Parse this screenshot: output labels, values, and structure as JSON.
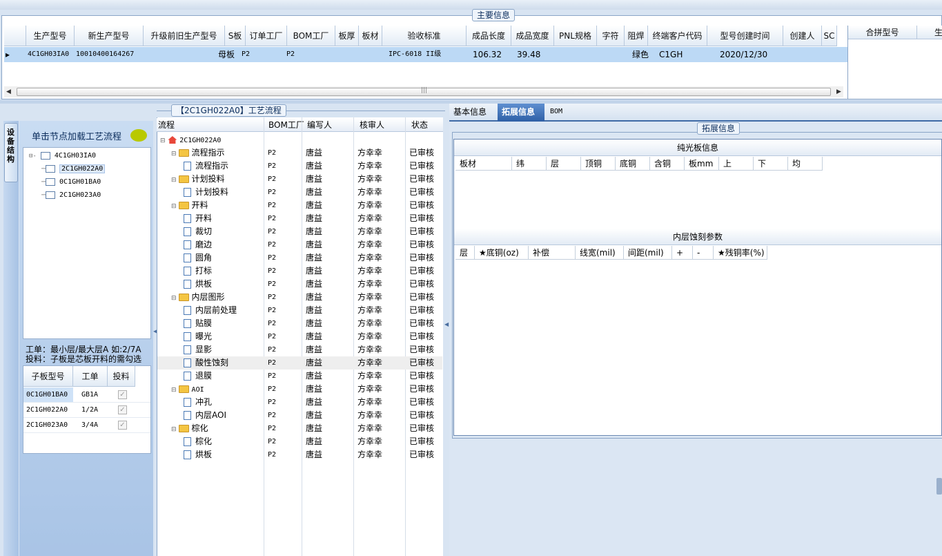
{
  "main_info": {
    "group_title": "主要信息",
    "columns": [
      "生产型号",
      "新生产型号",
      "升级前旧生产型号",
      "S板",
      "订单工厂",
      "BOM工厂",
      "板厚",
      "板材",
      "验收标准",
      "成品长度",
      "成品宽度",
      "PNL规格",
      "字符",
      "阻焊",
      "终端客户代码",
      "型号创建时间",
      "创建人",
      "SC"
    ],
    "row": {
      "pointer": "▸",
      "prod_model": "4C1GH03IA0",
      "new_model": "10010400164267",
      "s_board": "母板",
      "order_factory": "P2",
      "bom_factory": "P2",
      "standard": "IPC-6018 II级",
      "length": "106.32",
      "width": "39.48",
      "solder": "绿色",
      "customer": "C1GH",
      "created": "2020/12/30"
    },
    "side_columns": [
      "合拼型号",
      "生"
    ],
    "scroll_grip": "|||"
  },
  "left": {
    "side_tab": "设备结构",
    "load_label": "单击节点加载工艺流程",
    "tree": {
      "root": "4C1GH03IA0",
      "children": [
        "2C1GH022A0",
        "0C1GH01BA0",
        "2C1GH023A0"
      ]
    },
    "note1": "工单：最小层/最大层A 如:2/7A",
    "note2": "投料：子板是芯板开料的需勾选",
    "sub_headers": [
      "子板型号",
      "工单",
      "投料"
    ],
    "sub_rows": [
      {
        "model": "0C1GH01BA0",
        "order": "GB1A"
      },
      {
        "model": "2C1GH022A0",
        "order": "1/2A"
      },
      {
        "model": "2C1GH023A0",
        "order": "3/4A"
      }
    ],
    "check": "✓"
  },
  "flow": {
    "title": "【2C1GH022A0】工艺流程",
    "headers": [
      "流程",
      "BOM工厂",
      "编写人",
      "核审人",
      "状态"
    ],
    "root": "2C1GH022A0",
    "factory": "P2",
    "writer": "唐益",
    "reviewer": "方幸幸",
    "status": "已审核",
    "rows": [
      {
        "label": "流程指示",
        "type": "folder"
      },
      {
        "label": "流程指示",
        "type": "doc"
      },
      {
        "label": "计划投料",
        "type": "folder"
      },
      {
        "label": "计划投料",
        "type": "doc"
      },
      {
        "label": "开料",
        "type": "folder"
      },
      {
        "label": "开料",
        "type": "doc"
      },
      {
        "label": "裁切",
        "type": "doc"
      },
      {
        "label": "磨边",
        "type": "doc"
      },
      {
        "label": "圆角",
        "type": "doc"
      },
      {
        "label": "打标",
        "type": "doc"
      },
      {
        "label": "烘板",
        "type": "doc"
      },
      {
        "label": "内层图形",
        "type": "folder"
      },
      {
        "label": "内层前处理",
        "type": "doc"
      },
      {
        "label": "贴膜",
        "type": "doc"
      },
      {
        "label": "曝光",
        "type": "doc"
      },
      {
        "label": "显影",
        "type": "doc"
      },
      {
        "label": "酸性蚀刻",
        "type": "doc",
        "selected": true
      },
      {
        "label": "退膜",
        "type": "doc"
      },
      {
        "label": "AOI",
        "type": "folder"
      },
      {
        "label": "冲孔",
        "type": "doc"
      },
      {
        "label": "内层AOI",
        "type": "doc"
      },
      {
        "label": "棕化",
        "type": "folder"
      },
      {
        "label": "棕化",
        "type": "doc"
      },
      {
        "label": "烘板",
        "type": "doc"
      }
    ]
  },
  "right": {
    "tabs": [
      "基本信息",
      "拓展信息",
      "BOM"
    ],
    "active_tab": "拓展信息",
    "group_title": "拓展信息",
    "sec1_title": "纯光板信息",
    "sec1_cols": [
      "板材",
      "纬",
      "层",
      "顶铜",
      "底铜",
      "含铜",
      "板mm",
      "上",
      "下",
      "均"
    ],
    "sec2_title": "内层蚀刻参数",
    "sec2_cols": [
      "层",
      "★底铜(oz)",
      "补偿",
      "线宽(mil)",
      "间距(mil)",
      "+",
      "-",
      "★残铜率(%)"
    ]
  }
}
